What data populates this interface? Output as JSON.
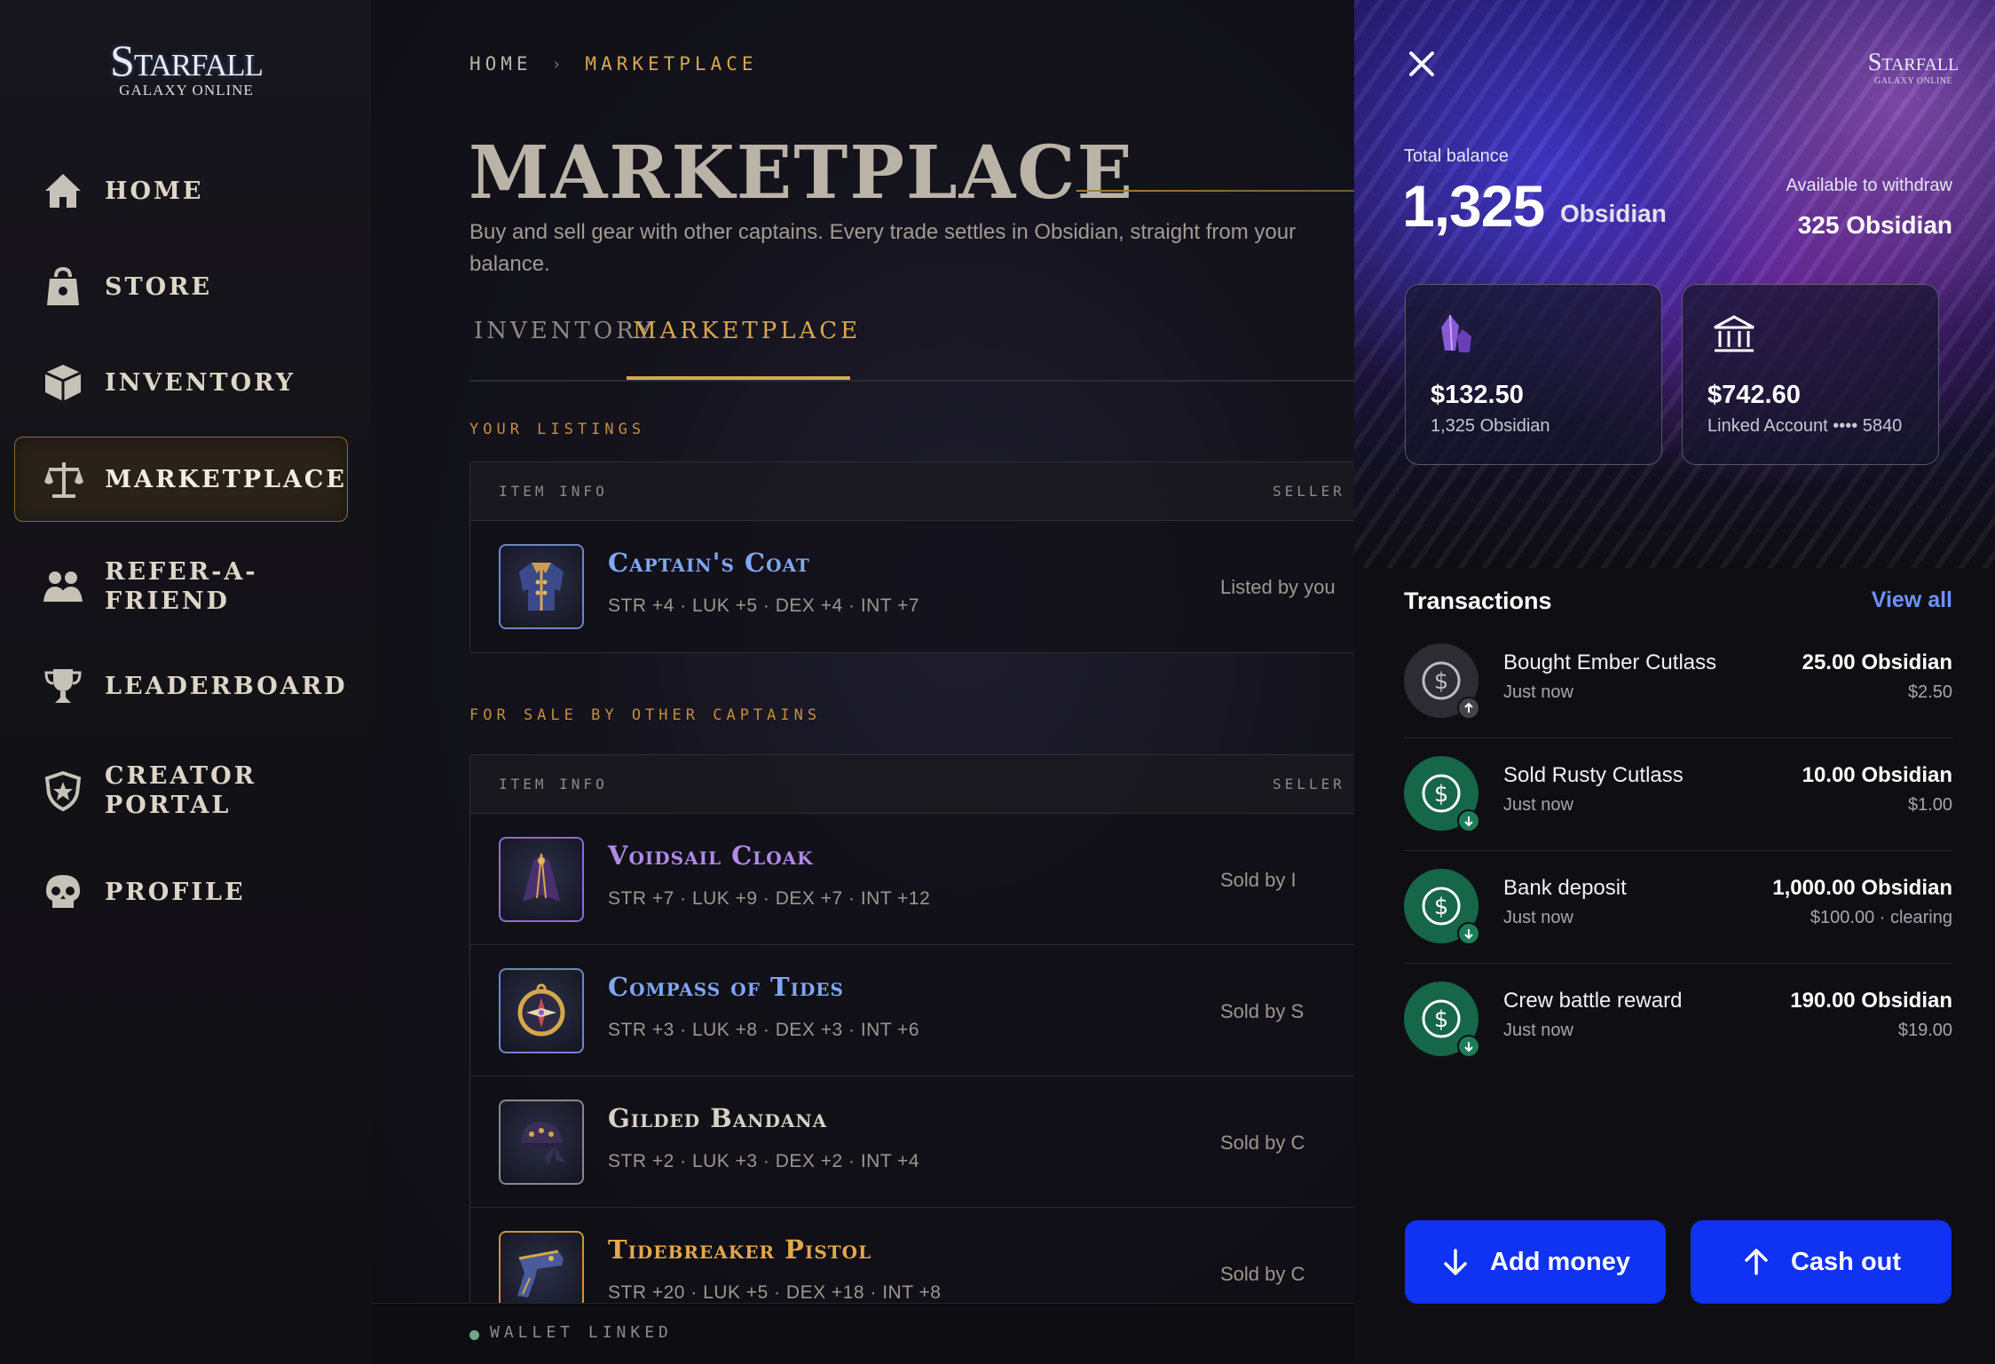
{
  "brand": {
    "logo_top": "Starfall",
    "logo_bottom": "GALAXY ONLINE"
  },
  "sidebar": {
    "items": [
      {
        "label": "HOME",
        "icon": "house-icon"
      },
      {
        "label": "STORE",
        "icon": "shop-bag-icon"
      },
      {
        "label": "INVENTORY",
        "icon": "crate-icon"
      },
      {
        "label": "MARKETPLACE",
        "icon": "scale-icon",
        "active": true
      },
      {
        "label": "REFER-A-FRIEND",
        "icon": "friends-icon"
      },
      {
        "label": "LEADERBOARD",
        "icon": "trophy-icon"
      },
      {
        "label": "CREATOR PORTAL",
        "icon": "shield-icon"
      },
      {
        "label": "PROFILE",
        "icon": "skull-icon"
      }
    ]
  },
  "breadcrumb": {
    "home": "HOME",
    "separator": "›",
    "current": "MARKETPLACE"
  },
  "page": {
    "title": "MARKETPLACE",
    "subtitle": "Buy and sell gear with other captains. Every trade settles in Obsidian, straight from your balance."
  },
  "tabs": [
    {
      "label": "INVENTORY"
    },
    {
      "label": "MARKETPLACE",
      "active": true
    }
  ],
  "your_listings": {
    "label": "YOUR LISTINGS",
    "columns": [
      "ITEM INFO",
      "SELLER"
    ],
    "rows": [
      {
        "name": "Captain's Coat",
        "stats": "STR +4 · LUK +5 · DEX +4 · INT +7",
        "seller": "Listed by you",
        "color": "#7fa7f5",
        "icon": "coat-icon"
      }
    ]
  },
  "for_sale": {
    "label": "FOR SALE BY OTHER CAPTAINS",
    "columns": [
      "ITEM INFO",
      "SELLER"
    ],
    "rows": [
      {
        "name": "Voidsail Cloak",
        "stats": "STR +7 · LUK +9 · DEX +7 · INT +12",
        "seller": "Sold by I",
        "color": "#b08ae6",
        "icon": "cloak-icon"
      },
      {
        "name": "Compass of Tides",
        "stats": "STR +3 · LUK +8 · DEX +3 · INT +6",
        "seller": "Sold by S",
        "color": "#7fa7f5",
        "icon": "compass-icon"
      },
      {
        "name": "Gilded Bandana",
        "stats": "STR +2 · LUK +3 · DEX +2 · INT +4",
        "seller": "Sold by C",
        "color": "#d8d2c6",
        "icon": "bandana-icon"
      },
      {
        "name": "Tidebreaker Pistol",
        "stats": "STR +20 · LUK +5 · DEX +18 · INT +8",
        "seller": "Sold by C",
        "color": "#e3a84c",
        "icon": "pistol-icon"
      }
    ]
  },
  "status": {
    "text": "WALLET LINKED"
  },
  "wallet": {
    "logo_top": "Starfall",
    "logo_bottom": "GALAXY ONLINE",
    "total_label": "Total balance",
    "total_value": "1,325",
    "total_unit": "Obsidian",
    "withdraw_label": "Available to withdraw",
    "withdraw_value": "325 Obsidian",
    "cards": [
      {
        "value": "$132.50",
        "sub": "1,325 Obsidian",
        "icon": "crystal-icon"
      },
      {
        "value": "$742.60",
        "sub": "Linked Account •••• 5840",
        "icon": "bank-icon"
      }
    ],
    "transactions_title": "Transactions",
    "view_all": "View all",
    "transactions": [
      {
        "name": "Bought Ember Cutlass",
        "time": "Just now",
        "amount": "25.00 Obsidian",
        "usd": "$2.50",
        "direction": "out"
      },
      {
        "name": "Sold Rusty Cutlass",
        "time": "Just now",
        "amount": "10.00 Obsidian",
        "usd": "$1.00",
        "direction": "in"
      },
      {
        "name": "Bank deposit",
        "time": "Just now",
        "amount": "1,000.00 Obsidian",
        "usd": "$100.00 · clearing",
        "direction": "in"
      },
      {
        "name": "Crew battle reward",
        "time": "Just now",
        "amount": "190.00 Obsidian",
        "usd": "$19.00",
        "direction": "in"
      }
    ],
    "add_money": "Add money",
    "cash_out": "Cash out"
  },
  "colors": {
    "gold": "#d9a84e",
    "accent_blue": "#1032f2",
    "link_blue": "#6d93ff",
    "income_green": "#16664a"
  }
}
